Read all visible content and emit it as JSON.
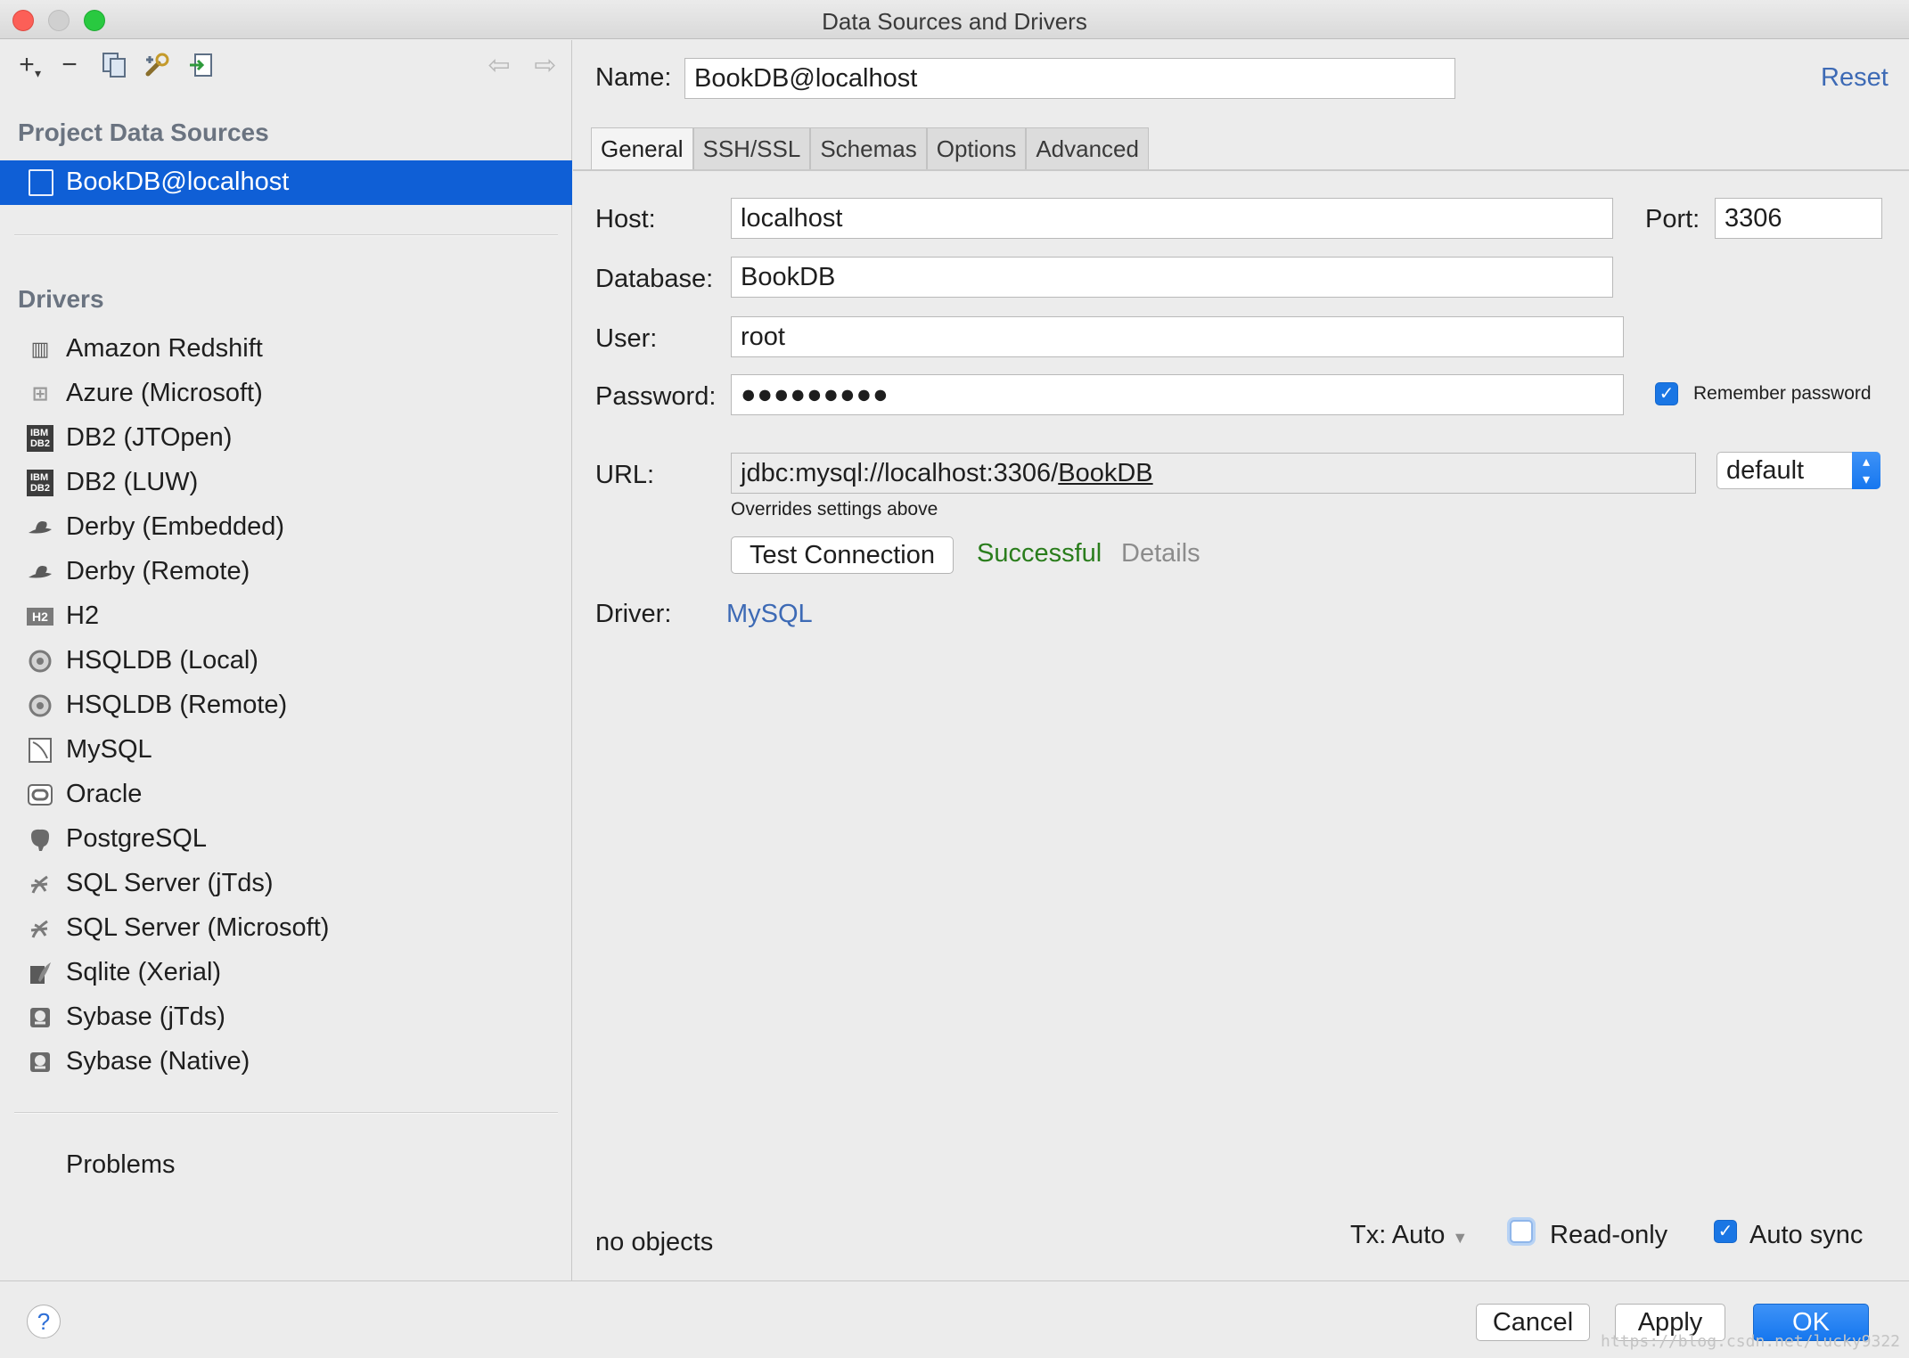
{
  "window": {
    "title": "Data Sources and Drivers"
  },
  "left": {
    "section_project": "Project Data Sources",
    "selected_source": "BookDB@localhost",
    "section_drivers": "Drivers",
    "drivers": [
      {
        "label": "Amazon Redshift",
        "icon": "redshift-icon"
      },
      {
        "label": "Azure (Microsoft)",
        "icon": "azure-icon"
      },
      {
        "label": "DB2 (JTOpen)",
        "icon": "db2-icon"
      },
      {
        "label": "DB2 (LUW)",
        "icon": "db2-icon"
      },
      {
        "label": "Derby (Embedded)",
        "icon": "derby-icon"
      },
      {
        "label": "Derby (Remote)",
        "icon": "derby-icon"
      },
      {
        "label": "H2",
        "icon": "h2-icon"
      },
      {
        "label": "HSQLDB (Local)",
        "icon": "hsqldb-icon"
      },
      {
        "label": "HSQLDB (Remote)",
        "icon": "hsqldb-icon"
      },
      {
        "label": "MySQL",
        "icon": "mysql-icon"
      },
      {
        "label": "Oracle",
        "icon": "oracle-icon"
      },
      {
        "label": "PostgreSQL",
        "icon": "postgresql-icon"
      },
      {
        "label": "SQL Server (jTds)",
        "icon": "sqlserver-icon"
      },
      {
        "label": "SQL Server (Microsoft)",
        "icon": "sqlserver-icon"
      },
      {
        "label": "Sqlite (Xerial)",
        "icon": "sqlite-icon"
      },
      {
        "label": "Sybase (jTds)",
        "icon": "sybase-icon"
      },
      {
        "label": "Sybase (Native)",
        "icon": "sybase-icon"
      }
    ],
    "problems": "Problems"
  },
  "form": {
    "name_label": "Name:",
    "name_value": "BookDB@localhost",
    "reset": "Reset",
    "tabs": [
      "General",
      "SSH/SSL",
      "Schemas",
      "Options",
      "Advanced"
    ],
    "active_tab": "General",
    "host_label": "Host:",
    "host_value": "localhost",
    "port_label": "Port:",
    "port_value": "3306",
    "database_label": "Database:",
    "database_value": "BookDB",
    "user_label": "User:",
    "user_value": "root",
    "password_label": "Password:",
    "password_value": "●●●●●●●●●",
    "remember_password": "Remember password",
    "remember_checked": true,
    "url_label": "URL:",
    "url_prefix": "jdbc:mysql://localhost:3306/",
    "url_db": "BookDB",
    "url_mode": "default",
    "overrides_note": "Overrides settings above",
    "test_connection": "Test Connection",
    "status": "Successful",
    "details": "Details",
    "driver_label": "Driver:",
    "driver_value": "MySQL",
    "objects": "no objects",
    "tx": "Tx: Auto",
    "readonly": "Read-only",
    "readonly_checked": false,
    "autosync": "Auto sync",
    "autosync_checked": true
  },
  "footer": {
    "help": "?",
    "cancel": "Cancel",
    "apply": "Apply",
    "ok": "OK",
    "watermark": "https://blog.csdn.net/lucky9322"
  },
  "colors": {
    "selection": "#0f5fd6",
    "link": "#3d6ab5",
    "success": "#2a7d1c",
    "muted": "#8c8c8c",
    "accent": "#1677ef"
  }
}
